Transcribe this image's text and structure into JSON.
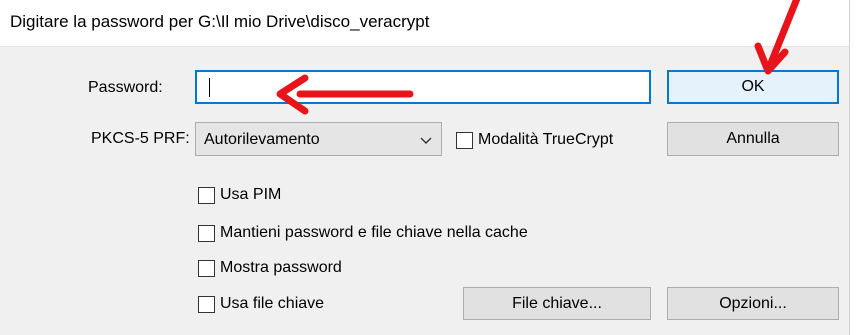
{
  "dialog": {
    "title": "Digitare la password per G:\\Il mio Drive\\disco_veracrypt",
    "password_label": "Password:",
    "password_value": "",
    "prf_label": "PKCS-5 PRF:",
    "prf_selected": "Autorilevamento",
    "truecrypt_mode_label": "Modalità TrueCrypt",
    "ok_label": "OK",
    "cancel_label": "Annulla",
    "options": [
      {
        "label": "Usa PIM",
        "checked": false
      },
      {
        "label": "Mantieni password e file chiave nella cache",
        "checked": false
      },
      {
        "label": "Mostra password",
        "checked": false
      },
      {
        "label": "Usa file chiave",
        "checked": false
      }
    ],
    "keyfiles_label": "File chiave...",
    "more_options_label": "Opzioni..."
  },
  "colors": {
    "accent": "#0078d7",
    "annotation_arrow": "#e8141a",
    "dialog_bg": "#f0f0f0"
  }
}
